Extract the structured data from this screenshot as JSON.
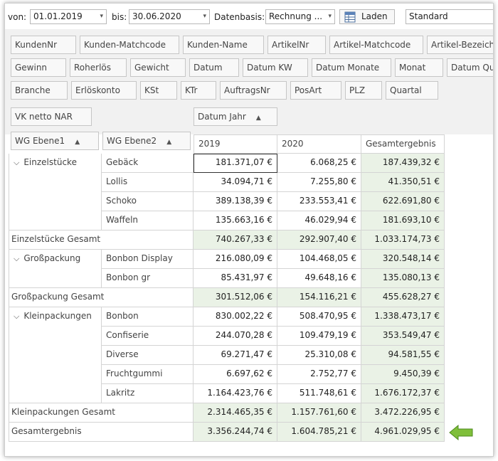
{
  "toolbar": {
    "von_label": "von:",
    "von_value": "01.01.2019",
    "bis_label": "bis:",
    "bis_value": "30.06.2020",
    "datenbasis_label": "Datenbasis:",
    "datenbasis_value": "Rechnung ...",
    "laden_label": "Laden",
    "layout_value": "Standard"
  },
  "fields_row1": [
    "KundenNr",
    "Kunden-Matchcode",
    "Kunden-Name",
    "ArtikelNr",
    "Artikel-Matchcode",
    "Artikel-Bezeichnung"
  ],
  "fields_row2": [
    "Gewinn",
    "Roherlös",
    "Gewicht",
    "Datum",
    "Datum KW",
    "Datum Monate",
    "Monat",
    "Datum Quartal"
  ],
  "fields_row3": [
    "Branche",
    "Erlöskonto",
    "KSt",
    "KTr",
    "AuftragsNr",
    "PosArt",
    "PLZ",
    "Quartal"
  ],
  "data_field": "VK netto NAR",
  "column_field": "Datum Jahr",
  "row_fields": [
    "WG Ebene1",
    "WG Ebene2"
  ],
  "columns": [
    "2019",
    "2020",
    "Gesamtergebnis"
  ],
  "groups": [
    {
      "name": "Einzelstücke",
      "items": [
        {
          "name": "Gebäck",
          "v2019": "181.371,07 €",
          "v2020": "6.068,25 €",
          "total": "187.439,32 €"
        },
        {
          "name": "Lollis",
          "v2019": "34.094,71 €",
          "v2020": "7.255,80 €",
          "total": "41.350,51 €"
        },
        {
          "name": "Schoko",
          "v2019": "389.138,39 €",
          "v2020": "233.553,41 €",
          "total": "622.691,80 €"
        },
        {
          "name": "Waffeln",
          "v2019": "135.663,16 €",
          "v2020": "46.029,94 €",
          "total": "181.693,10 €"
        }
      ],
      "subtotal_label": "Einzelstücke Gesamt",
      "subtotal": {
        "v2019": "740.267,33 €",
        "v2020": "292.907,40 €",
        "total": "1.033.174,73 €"
      }
    },
    {
      "name": "Großpackung",
      "items": [
        {
          "name": "Bonbon Display",
          "v2019": "216.080,09 €",
          "v2020": "104.468,05 €",
          "total": "320.548,14 €"
        },
        {
          "name": "Bonbon gr",
          "v2019": "85.431,97 €",
          "v2020": "49.648,16 €",
          "total": "135.080,13 €"
        }
      ],
      "subtotal_label": "Großpackung Gesamt",
      "subtotal": {
        "v2019": "301.512,06 €",
        "v2020": "154.116,21 €",
        "total": "455.628,27 €"
      }
    },
    {
      "name": "Kleinpackungen",
      "items": [
        {
          "name": "Bonbon",
          "v2019": "830.002,22 €",
          "v2020": "508.470,95 €",
          "total": "1.338.473,17 €"
        },
        {
          "name": "Confiserie",
          "v2019": "244.070,28 €",
          "v2020": "109.479,19 €",
          "total": "353.549,47 €"
        },
        {
          "name": "Diverse",
          "v2019": "69.271,47 €",
          "v2020": "25.310,08 €",
          "total": "94.581,55 €"
        },
        {
          "name": "Fruchtgummi",
          "v2019": "6.697,62 €",
          "v2020": "2.752,77 €",
          "total": "9.450,39 €"
        },
        {
          "name": "Lakritz",
          "v2019": "1.164.423,76 €",
          "v2020": "511.748,61 €",
          "total": "1.676.172,37 €"
        }
      ],
      "subtotal_label": "Kleinpackungen Gesamt",
      "subtotal": {
        "v2019": "2.314.465,35 €",
        "v2020": "1.157.761,60 €",
        "total": "3.472.226,95 €"
      }
    }
  ],
  "grand_total_label": "Gesamtergebnis",
  "grand_total": {
    "v2019": "3.356.244,74 €",
    "v2020": "1.604.785,21 €",
    "total": "4.961.029,95 €"
  },
  "colors": {
    "total_bg": "#eaf2e6",
    "arrow_green": "#7fbf3a"
  },
  "icons": {
    "expand": "chevron-down-icon",
    "sort": "sort-asc-icon",
    "laden": "table-load-icon",
    "arrow": "arrow-left-icon"
  }
}
